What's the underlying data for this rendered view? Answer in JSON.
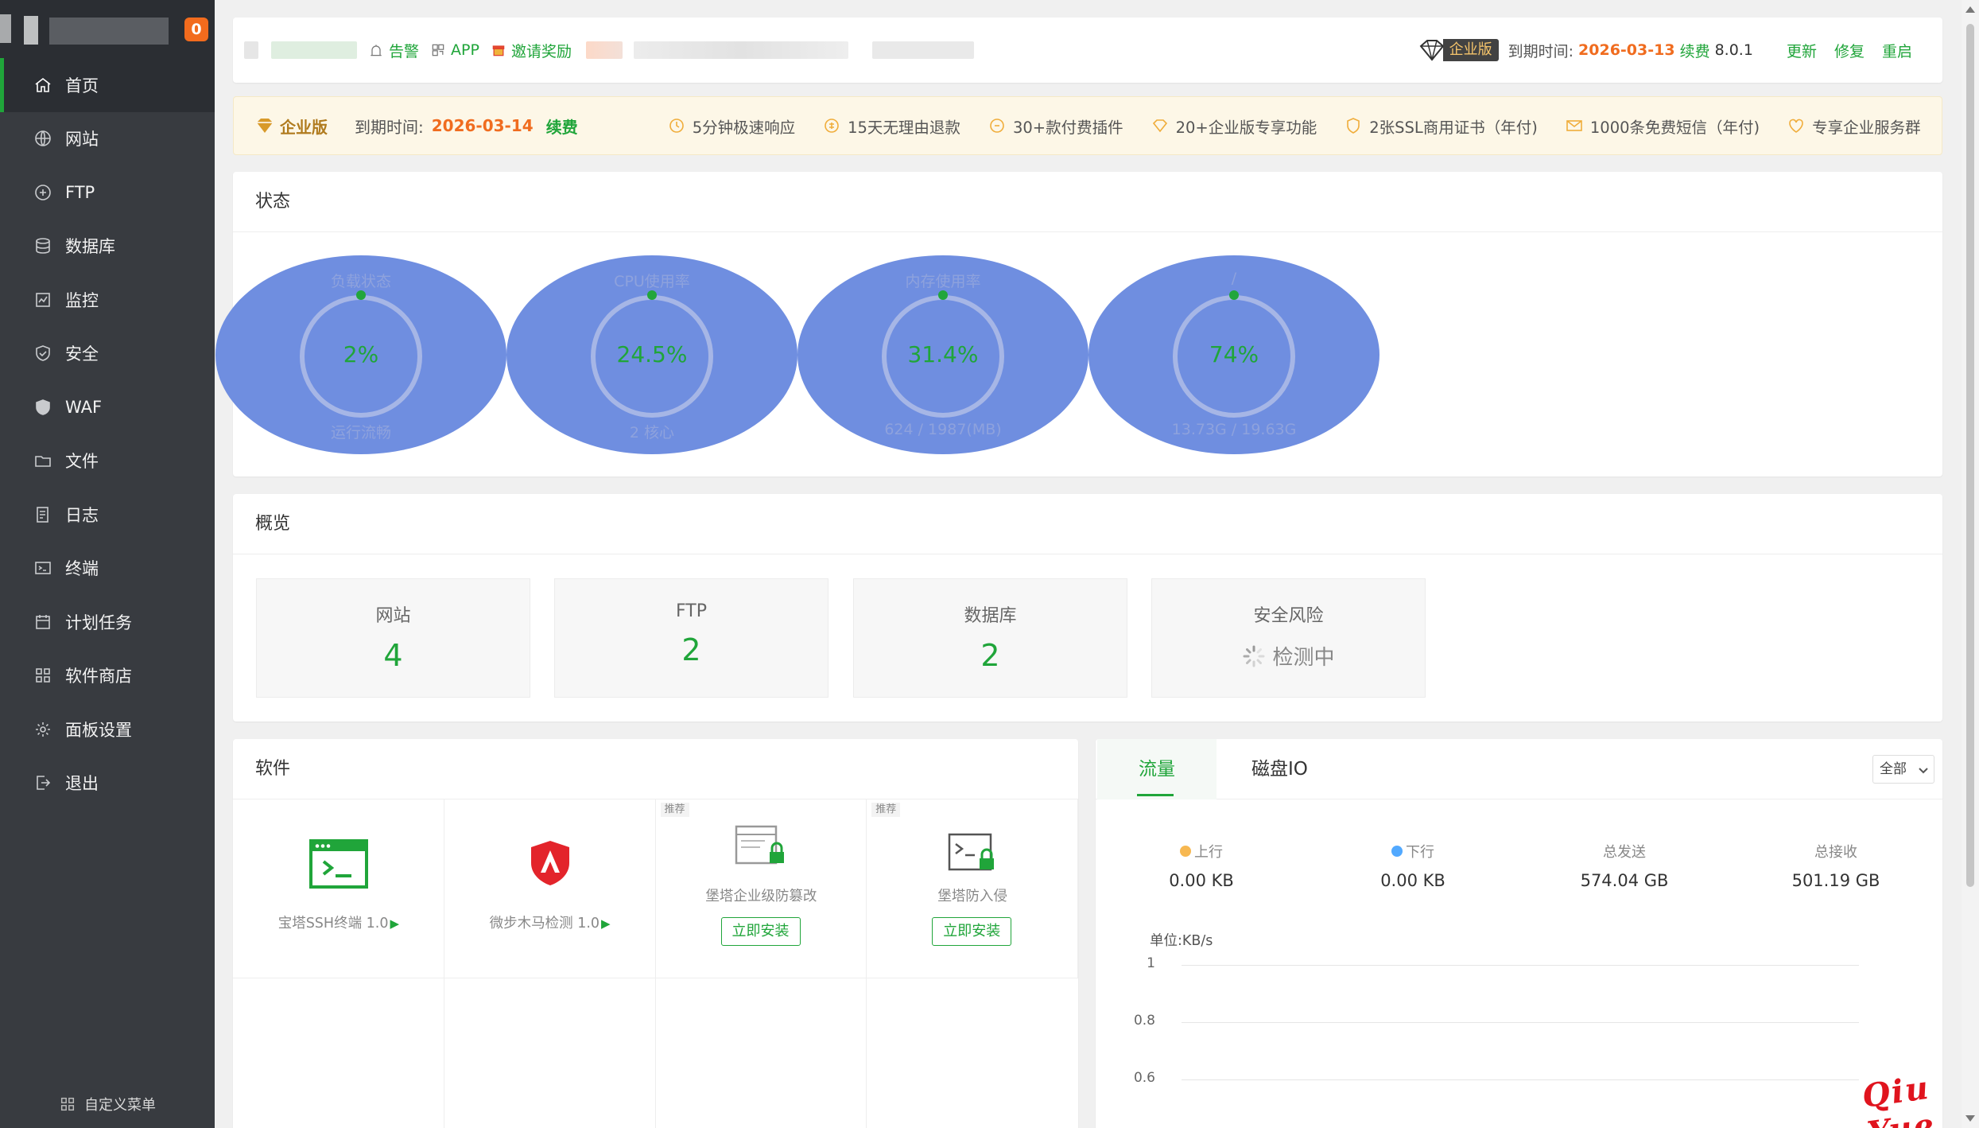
{
  "sidebar": {
    "badge": "0",
    "items": [
      {
        "label": "首页",
        "icon": "home-icon"
      },
      {
        "label": "网站",
        "icon": "globe-icon"
      },
      {
        "label": "FTP",
        "icon": "ftp-icon"
      },
      {
        "label": "数据库",
        "icon": "database-icon"
      },
      {
        "label": "监控",
        "icon": "monitor-icon"
      },
      {
        "label": "安全",
        "icon": "shield-icon"
      },
      {
        "label": "WAF",
        "icon": "waf-shield-icon"
      },
      {
        "label": "文件",
        "icon": "folder-icon"
      },
      {
        "label": "日志",
        "icon": "log-icon"
      },
      {
        "label": "终端",
        "icon": "terminal-icon"
      },
      {
        "label": "计划任务",
        "icon": "calendar-icon"
      },
      {
        "label": "软件商店",
        "icon": "apps-icon"
      },
      {
        "label": "面板设置",
        "icon": "gear-icon"
      },
      {
        "label": "退出",
        "icon": "logout-icon"
      }
    ],
    "footer": "自定义菜单"
  },
  "topbar": {
    "links": [
      "告警",
      "APP",
      "邀请奖励"
    ],
    "edition": "企业版",
    "expire_label": "到期时间:",
    "expire_date": "2026-03-13",
    "renew": "续费",
    "version": "8.0.1",
    "actions": [
      "更新",
      "修复",
      "重启"
    ]
  },
  "banner": {
    "edition": "企业版",
    "expire_label": "到期时间:",
    "expire_date": "2026-03-14",
    "renew": "续费",
    "features": [
      {
        "label": "5分钟极速响应",
        "icon": "clock-support-icon"
      },
      {
        "label": "15天无理由退款",
        "icon": "refund-icon"
      },
      {
        "label": "30+款付费插件",
        "icon": "plugin-icon"
      },
      {
        "label": "20+企业版专享功能",
        "icon": "diamond-icon"
      },
      {
        "label": "2张SSL商用证书（年付)",
        "icon": "ssl-icon"
      },
      {
        "label": "1000条免费短信（年付)",
        "icon": "mail-icon"
      },
      {
        "label": "专享企业服务群",
        "icon": "heart-group-icon"
      }
    ]
  },
  "status": {
    "title": "状态",
    "gauges": [
      {
        "title": "负载状态",
        "value": "2%",
        "sub": "运行流畅"
      },
      {
        "title": "CPU使用率",
        "value": "24.5%",
        "sub": "2 核心"
      },
      {
        "title": "内存使用率",
        "value": "31.4%",
        "sub": "624 / 1987(MB)"
      },
      {
        "title": "/",
        "value": "74%",
        "sub": "13.73G / 19.63G"
      }
    ]
  },
  "overview": {
    "title": "概览",
    "cards": [
      {
        "label": "网站",
        "value": "4"
      },
      {
        "label": "FTP",
        "value": "2"
      },
      {
        "label": "数据库",
        "value": "2"
      },
      {
        "label": "安全风险",
        "value": "检测中"
      }
    ]
  },
  "software": {
    "title": "软件",
    "items": [
      {
        "name": "宝塔SSH终端 1.0",
        "recommend": "",
        "install": ""
      },
      {
        "name": "微步木马检测 1.0",
        "recommend": "",
        "install": ""
      },
      {
        "name": "堡塔企业级防篡改",
        "recommend": "推荐",
        "install": "立即安装"
      },
      {
        "name": "堡塔防入侵",
        "recommend": "推荐",
        "install": "立即安装"
      }
    ]
  },
  "flow": {
    "tabs": [
      "流量",
      "磁盘IO"
    ],
    "select": "全部",
    "stats": [
      {
        "label": "上行",
        "value": "0.00 KB",
        "color": "#f7b851"
      },
      {
        "label": "下行",
        "value": "0.00 KB",
        "color": "#52a9ff"
      },
      {
        "label": "总发送",
        "value": "574.04 GB",
        "color": ""
      },
      {
        "label": "总接收",
        "value": "501.19 GB",
        "color": ""
      }
    ],
    "unit": "单位:KB/s",
    "yticks": [
      "1",
      "0.8",
      "0.6"
    ]
  },
  "colors": {
    "accent": "#20a53a",
    "orange": "#f06c1f",
    "sidebar": "#383b40",
    "gauge_bg": "#6f8ee0"
  },
  "watermark": "Qiu Yue"
}
